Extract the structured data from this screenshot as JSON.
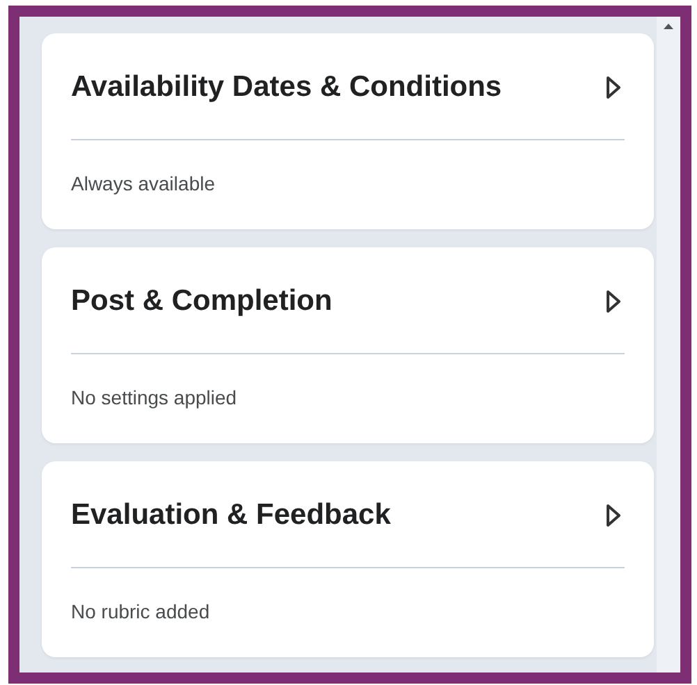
{
  "sections": [
    {
      "title": "Availability Dates & Conditions",
      "summary": "Always available",
      "expanded": false
    },
    {
      "title": "Post & Completion",
      "summary": "No settings applied",
      "expanded": false
    },
    {
      "title": "Evaluation & Feedback",
      "summary": "No rubric added",
      "expanded": false
    }
  ]
}
